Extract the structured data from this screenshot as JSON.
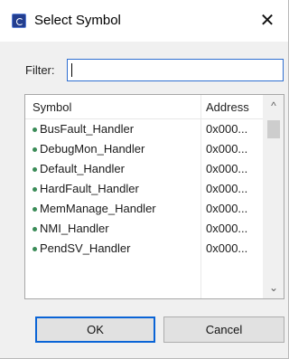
{
  "window": {
    "title": "Select Symbol",
    "close_glyph": "✕",
    "app_icon": "eclipse-app-icon"
  },
  "filter": {
    "label": "Filter:",
    "value": ""
  },
  "table": {
    "columns": [
      "Symbol",
      "Address"
    ],
    "rows": [
      {
        "symbol": "BusFault_Handler",
        "address": "0x000..."
      },
      {
        "symbol": "DebugMon_Handler",
        "address": "0x000..."
      },
      {
        "symbol": "Default_Handler",
        "address": "0x000..."
      },
      {
        "symbol": "HardFault_Handler",
        "address": "0x000..."
      },
      {
        "symbol": "MemManage_Handler",
        "address": "0x000..."
      },
      {
        "symbol": "NMI_Handler",
        "address": "0x000..."
      },
      {
        "symbol": "PendSV_Handler",
        "address": "0x000..."
      }
    ],
    "symbol_dot_color": "#3a8b57",
    "scroll_up_glyph": "^",
    "scroll_down_glyph": "⌄"
  },
  "buttons": {
    "ok_label": "OK",
    "cancel_label": "Cancel",
    "accent_color": "#0a64d6"
  }
}
